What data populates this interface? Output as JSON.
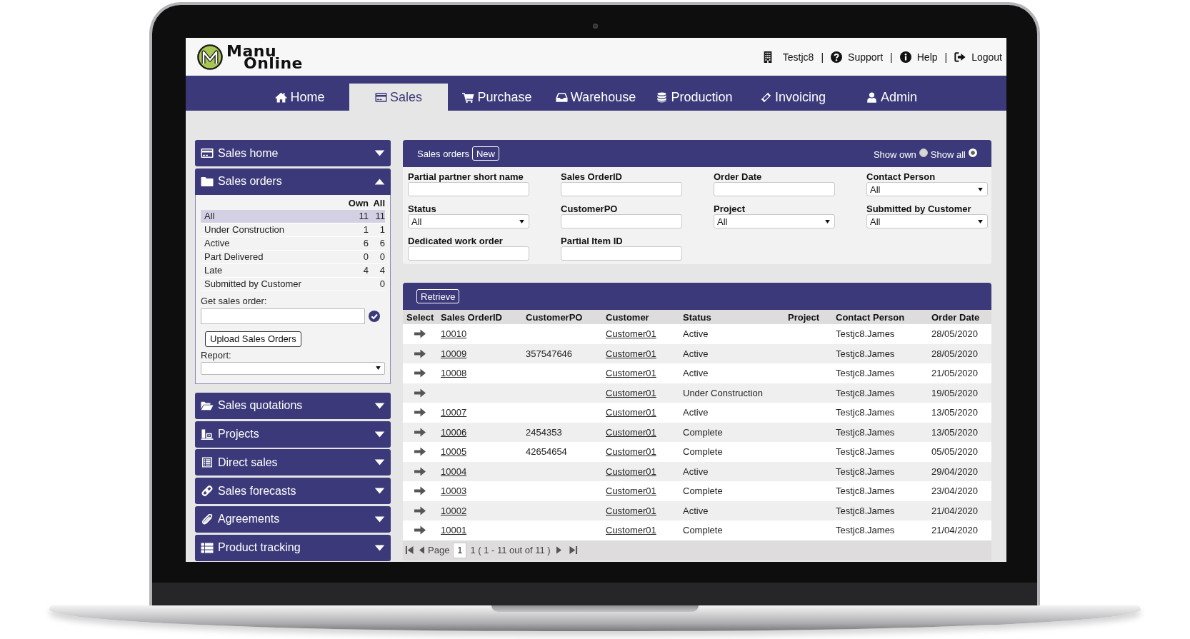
{
  "header": {
    "logo": {
      "lines": [
        "Manu",
        "Online"
      ]
    },
    "items": [
      {
        "kind": "company",
        "label": "Testjc8"
      },
      {
        "kind": "separator",
        "text": "|"
      },
      {
        "kind": "support",
        "label": "Support"
      },
      {
        "kind": "separator",
        "text": "|"
      },
      {
        "kind": "help",
        "label": "Help"
      },
      {
        "kind": "separator",
        "text": "|"
      },
      {
        "kind": "logout",
        "label": "Logout"
      }
    ]
  },
  "nav": {
    "tabs": [
      {
        "kind": "home",
        "label": "Home",
        "selected": false
      },
      {
        "kind": "sales",
        "label": "Sales",
        "selected": true
      },
      {
        "kind": "purchase",
        "label": "Purchase",
        "selected": false
      },
      {
        "kind": "warehouse",
        "label": "Warehouse",
        "selected": false
      },
      {
        "kind": "production",
        "label": "Production",
        "selected": false
      },
      {
        "kind": "invoicing",
        "label": "Invoicing",
        "selected": false
      },
      {
        "kind": "admin",
        "label": "Admin",
        "selected": false
      }
    ]
  },
  "sidebar": {
    "sections": [
      {
        "kind": "sales_home",
        "title": "Sales home",
        "expanded": false
      },
      {
        "kind": "sales_orders",
        "title": "Sales orders",
        "expanded": true,
        "counts": {
          "columns": [
            "Own",
            "All"
          ],
          "rows": [
            {
              "label": "All",
              "own": "11",
              "all": "11",
              "selected": true
            },
            {
              "label": "Under Construction",
              "own": "1",
              "all": "1",
              "selected": false
            },
            {
              "label": "Active",
              "own": "6",
              "all": "6",
              "selected": false
            },
            {
              "label": "Part Delivered",
              "own": "0",
              "all": "0",
              "selected": false
            },
            {
              "label": "Late",
              "own": "4",
              "all": "4",
              "selected": false
            },
            {
              "label": "Submitted by Customer",
              "all": "0",
              "selected": false
            }
          ]
        },
        "lookup_label": "Get sales order:",
        "upload_button": "Upload Sales Orders",
        "report_label": "Report:"
      },
      {
        "kind": "sales_quotations",
        "title": "Sales quotations",
        "expanded": false
      },
      {
        "kind": "projects",
        "title": "Projects",
        "expanded": false
      },
      {
        "kind": "direct_sales",
        "title": "Direct sales",
        "expanded": false
      },
      {
        "kind": "sales_forecasts",
        "title": "Sales forecasts",
        "expanded": false
      },
      {
        "kind": "agreements",
        "title": "Agreements",
        "expanded": false
      },
      {
        "kind": "product_tracking",
        "title": "Product tracking",
        "expanded": false
      }
    ]
  },
  "orders_panel": {
    "title": "Sales orders",
    "new_button": "New",
    "view_options": [
      {
        "label": "Show own",
        "selected": false
      },
      {
        "label": "Show all",
        "selected": true
      }
    ],
    "filters": [
      {
        "kind": "text",
        "label": "Partial partner short name"
      },
      {
        "kind": "text",
        "label": "Sales OrderID"
      },
      {
        "kind": "text",
        "label": "Order Date"
      },
      {
        "kind": "select",
        "label": "Contact Person",
        "value": "All"
      },
      {
        "kind": "select",
        "label": "Status",
        "value": "All"
      },
      {
        "kind": "text",
        "label": "CustomerPO"
      },
      {
        "kind": "select",
        "label": "Project",
        "value": "All"
      },
      {
        "kind": "select",
        "label": "Submitted by Customer",
        "value": "All"
      },
      {
        "kind": "text",
        "label": "Dedicated work order"
      },
      {
        "kind": "text",
        "label": "Partial Item ID"
      }
    ]
  },
  "results": {
    "retrieve_button": "Retrieve",
    "table": {
      "columns": [
        "Select",
        "Sales OrderID",
        "CustomerPO",
        "Customer",
        "Status",
        "Project",
        "Contact Person",
        "Order Date"
      ],
      "rows": [
        {
          "sales_order_id": "10010",
          "customer": "Customer01",
          "status": "Active",
          "contact_person": "Testjc8.James",
          "order_date": "28/05/2020"
        },
        {
          "sales_order_id": "10009",
          "customer_po": "357547646",
          "customer": "Customer01",
          "status": "Active",
          "contact_person": "Testjc8.James",
          "order_date": "28/05/2020"
        },
        {
          "sales_order_id": "10008",
          "customer": "Customer01",
          "status": "Active",
          "contact_person": "Testjc8.James",
          "order_date": "21/05/2020"
        },
        {
          "customer": "Customer01",
          "status": "Under Construction",
          "contact_person": "Testjc8.James",
          "order_date": "19/05/2020"
        },
        {
          "sales_order_id": "10007",
          "customer": "Customer01",
          "status": "Active",
          "contact_person": "Testjc8.James",
          "order_date": "13/05/2020"
        },
        {
          "sales_order_id": "10006",
          "customer_po": "2454353",
          "customer": "Customer01",
          "status": "Complete",
          "contact_person": "Testjc8.James",
          "order_date": "13/05/2020"
        },
        {
          "sales_order_id": "10005",
          "customer_po": "42654654",
          "customer": "Customer01",
          "status": "Complete",
          "contact_person": "Testjc8.James",
          "order_date": "05/05/2020"
        },
        {
          "sales_order_id": "10004",
          "customer": "Customer01",
          "status": "Active",
          "contact_person": "Testjc8.James",
          "order_date": "29/04/2020"
        },
        {
          "sales_order_id": "10003",
          "customer": "Customer01",
          "status": "Complete",
          "contact_person": "Testjc8.James",
          "order_date": "23/04/2020"
        },
        {
          "sales_order_id": "10002",
          "customer": "Customer01",
          "status": "Active",
          "contact_person": "Testjc8.James",
          "order_date": "21/04/2020"
        },
        {
          "sales_order_id": "10001",
          "customer": "Customer01",
          "status": "Complete",
          "contact_person": "Testjc8.James",
          "order_date": "21/04/2020"
        }
      ]
    },
    "pagination": {
      "label": "Page",
      "page": "1",
      "summary": "1 ( 1 - 11 out of 11 )"
    }
  }
}
